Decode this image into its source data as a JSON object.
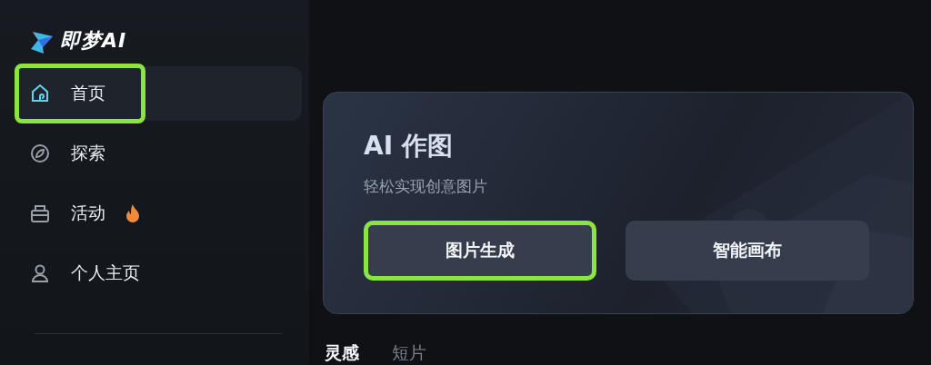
{
  "logo": {
    "text": "即梦AI"
  },
  "sidebar": {
    "items": [
      {
        "label": "首页",
        "selected": true,
        "highlighted": true,
        "hot": false
      },
      {
        "label": "探索",
        "selected": false,
        "highlighted": false,
        "hot": false
      },
      {
        "label": "活动",
        "selected": false,
        "highlighted": false,
        "hot": true
      },
      {
        "label": "个人主页",
        "selected": false,
        "highlighted": false,
        "hot": false
      }
    ]
  },
  "card": {
    "title": "AI 作图",
    "subtitle": "轻松实现创意图片",
    "buttons": [
      {
        "label": "图片生成",
        "highlighted": true
      },
      {
        "label": "智能画布",
        "highlighted": false
      }
    ]
  },
  "tabs": [
    {
      "label": "灵感",
      "selected": true
    },
    {
      "label": "短片",
      "selected": false
    }
  ]
}
